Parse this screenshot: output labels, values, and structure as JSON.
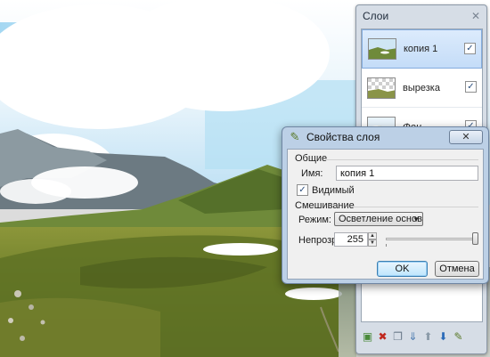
{
  "layers_panel": {
    "title": "Слои",
    "close_glyph": "✕",
    "items": [
      {
        "label": "копия 1",
        "italic": false,
        "visible": true,
        "selected": true
      },
      {
        "label": "вырезка",
        "italic": false,
        "visible": true,
        "selected": false
      },
      {
        "label": "Фон",
        "italic": true,
        "visible": true,
        "selected": false
      }
    ],
    "checkmark": "✓",
    "toolbar_icons": [
      "add-layer-icon",
      "delete-layer-icon",
      "duplicate-layer-icon",
      "merge-down-icon",
      "move-up-icon",
      "move-down-icon",
      "layer-properties-icon"
    ],
    "toolbar_glyphs": [
      "▣",
      "✖",
      "❐",
      "⇓",
      "⬆",
      "⬇",
      "✎"
    ]
  },
  "dialog": {
    "title": "Свойства слоя",
    "close_label": "✕",
    "general": {
      "group_label": "Общие",
      "name_label": "Имя:",
      "name_value": "копия 1",
      "visible_label": "Видимый",
      "visible_checked": true
    },
    "blending": {
      "group_label": "Смешивание",
      "mode_label": "Режим:",
      "mode_value": "Осветление основы",
      "opacity_label": "Непрозр.:",
      "opacity_value": "255",
      "opacity_fraction": 1.0
    },
    "ok_label": "OK",
    "cancel_label": "Отмена"
  },
  "colors": {
    "accent": "#3c7fb1",
    "sky": "#9fd3f0",
    "grass": "#7a8a2c"
  }
}
